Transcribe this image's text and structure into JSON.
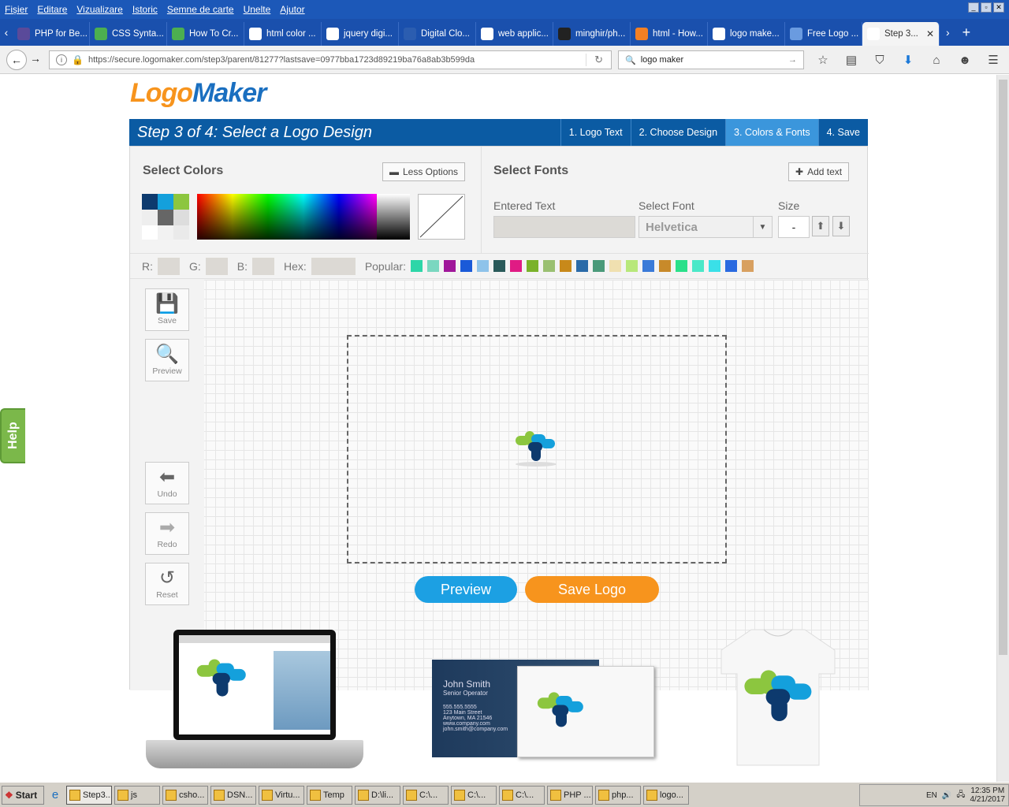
{
  "menu": [
    "Fișier",
    "Editare",
    "Vizualizare",
    "Istoric",
    "Semne de carte",
    "Unelte",
    "Ajutor"
  ],
  "window_controls": [
    "_",
    "▫",
    "✕"
  ],
  "tabs": [
    {
      "label": "PHP for Be...",
      "icon": "page-icon",
      "color": "#5a4a9a"
    },
    {
      "label": "CSS Synta...",
      "icon": "w3-icon",
      "color": "#4caf50"
    },
    {
      "label": "How To Cr...",
      "icon": "w3-icon",
      "color": "#4caf50"
    },
    {
      "label": "html color ...",
      "icon": "google-icon",
      "color": "#ffffff"
    },
    {
      "label": "jquery digi...",
      "icon": "google-icon",
      "color": "#ffffff"
    },
    {
      "label": "Digital Clo...",
      "icon": "page-icon",
      "color": "#2b5db0"
    },
    {
      "label": "web applic...",
      "icon": "google-icon",
      "color": "#ffffff"
    },
    {
      "label": "minghir/ph...",
      "icon": "github-icon",
      "color": "#222222"
    },
    {
      "label": "html - How...",
      "icon": "stackoverflow-icon",
      "color": "#f48024"
    },
    {
      "label": "logo make...",
      "icon": "google-icon",
      "color": "#ffffff"
    },
    {
      "label": "Free Logo ...",
      "icon": "logo-icon",
      "color": "#6a9be0"
    },
    {
      "label": "Step 3...",
      "icon": "lm-icon",
      "color": "#ffffff",
      "active": true
    }
  ],
  "address": {
    "url": "https://secure.logomaker.com/step3/parent/81277?lastsave=0977bba1723d89219ba76a8ab3b599da"
  },
  "search": {
    "value": "logo maker"
  },
  "page": {
    "brand_a": "Logo",
    "brand_b": "Maker",
    "step_title": "Step 3 of 4: Select a Logo Design",
    "steps": [
      "1. Logo Text",
      "2. Choose Design",
      "3. Colors & Fonts",
      "4. Save"
    ],
    "active_step": 2,
    "colors_heading": "Select Colors",
    "less_options": "Less Options",
    "fonts_heading": "Select Fonts",
    "add_text": "Add text",
    "entered_text_label": "Entered Text",
    "entered_text_value": "",
    "select_font_label": "Select Font",
    "font_value": "Helvetica",
    "size_label": "Size",
    "size_value": "-",
    "r_label": "R:",
    "g_label": "G:",
    "b_label": "B:",
    "hex_label": "Hex:",
    "popular_label": "Popular:",
    "popular_colors": [
      "#2dd6a8",
      "#7ad7c0",
      "#a0179a",
      "#1a5ad8",
      "#8ec3ea",
      "#2a5a5a",
      "#e01b84",
      "#7ab22a",
      "#9ac071",
      "#c8891a",
      "#2a6aa8",
      "#4a9a7a",
      "#f0e0b0",
      "#b8e87a",
      "#3a7ad8",
      "#c88a2a",
      "#2ae08a",
      "#4ae8c8",
      "#3ae0e8",
      "#2a6ae0",
      "#d8a060"
    ],
    "swatches": [
      "#0d3a6e",
      "#14a0dc",
      "#8cc63f",
      "#eeeeee",
      "#666666",
      "#dddddd",
      "#ffffff",
      "#f2f2f2",
      "#eaeaea"
    ],
    "tools": [
      {
        "label": "Save",
        "icon": "floppy-icon"
      },
      {
        "label": "Preview",
        "icon": "magnifier-icon"
      },
      {
        "label": "Undo",
        "icon": "undo-arrow-icon"
      },
      {
        "label": "Redo",
        "icon": "redo-arrow-icon"
      },
      {
        "label": "Reset",
        "icon": "reset-icon"
      }
    ],
    "preview_btn": "Preview",
    "save_logo_btn": "Save Logo",
    "help": "Help",
    "card_name": "John Smith",
    "card_title": "Senior Operator",
    "card_lines": [
      "555.555.5555",
      "123 Main Street",
      "Anytown, MA 21546",
      "www.company.com",
      "john.smith@company.com"
    ]
  },
  "taskbar": {
    "start": "Start",
    "items": [
      "Step3...",
      "js",
      "csho...",
      "DSN...",
      "Virtu...",
      "Temp",
      "D:\\li...",
      "C:\\...",
      "C:\\...",
      "C:\\...",
      "PHP ...",
      "php...",
      "logo..."
    ],
    "lang": "EN",
    "time": "12:35 PM",
    "date": "4/21/2017"
  }
}
